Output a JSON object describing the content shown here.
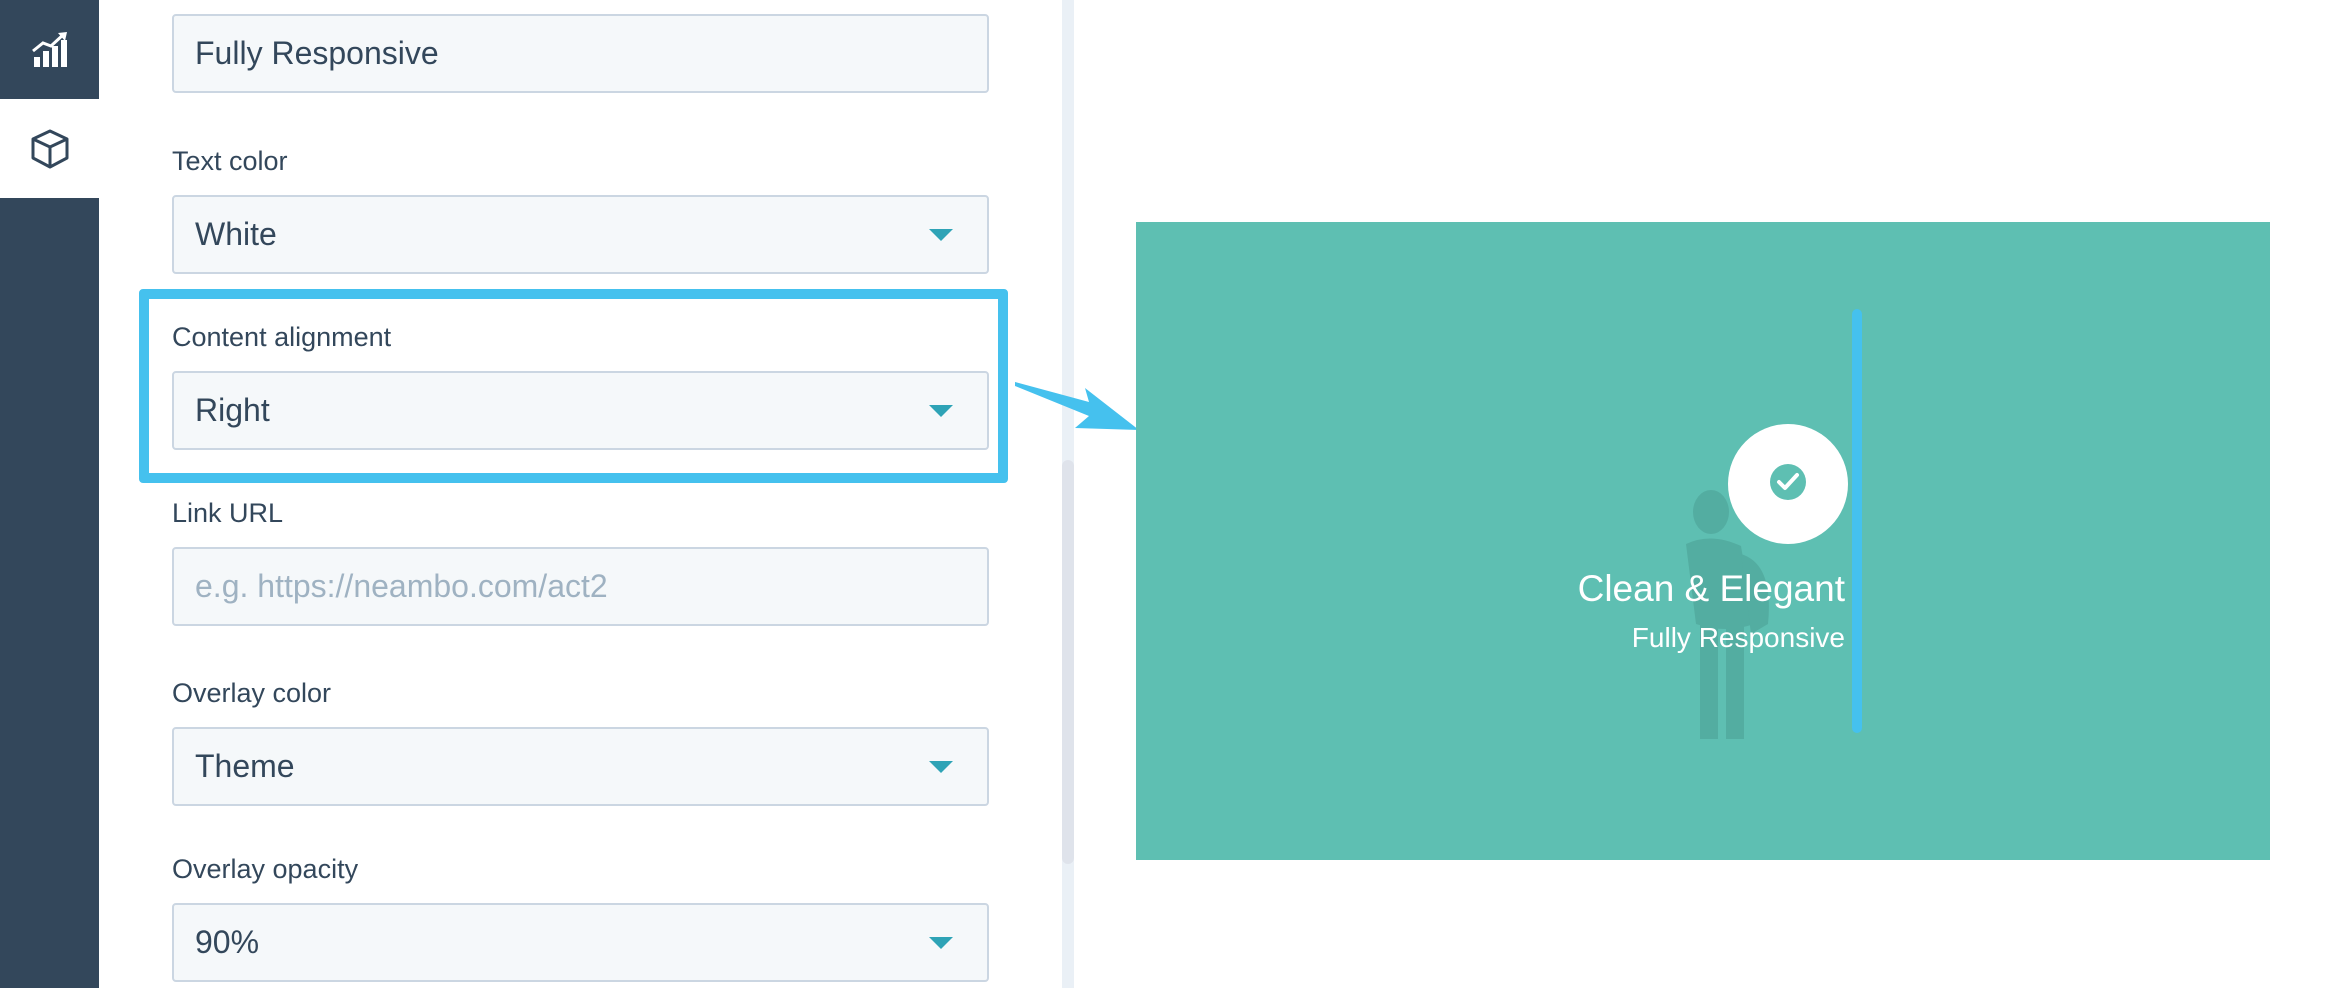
{
  "sidebar": {
    "items": [
      {
        "icon": "analytics-chart-icon",
        "active": false
      },
      {
        "icon": "module-box-icon",
        "active": true
      }
    ]
  },
  "form": {
    "subtitle_value": "Fully Responsive",
    "text_color": {
      "label": "Text color",
      "value": "White"
    },
    "content_alignment": {
      "label": "Content alignment",
      "value": "Right"
    },
    "link_url": {
      "label": "Link URL",
      "placeholder": "e.g. https://neambo.com/act2"
    },
    "overlay_color": {
      "label": "Overlay color",
      "value": "Theme"
    },
    "overlay_opacity": {
      "label": "Overlay opacity",
      "value": "90%"
    }
  },
  "preview": {
    "title": "Clean & Elegant",
    "subtitle": "Fully Responsive",
    "overlay_hex": "#5ebfb2",
    "accent_hex": "#45c1ee",
    "badge_icon": "check-circle-icon"
  }
}
